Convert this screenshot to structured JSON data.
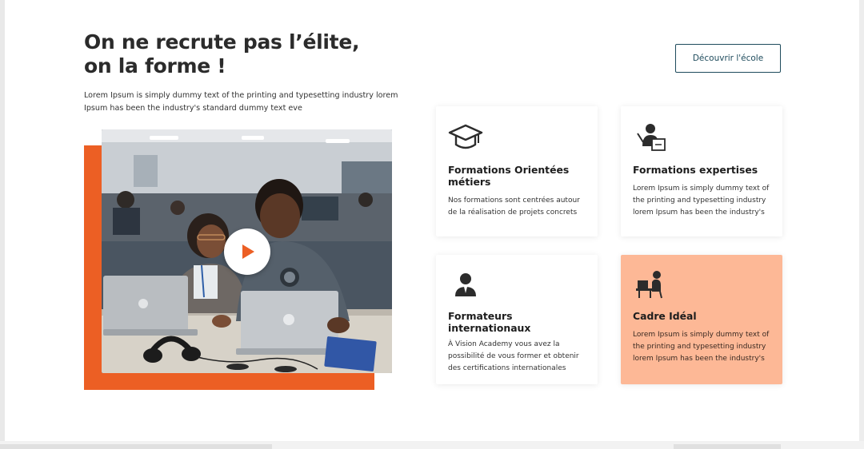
{
  "hero": {
    "title_line1": "On ne recrute pas l’élite,",
    "title_line2": "on la forme !",
    "description": "Lorem Ipsum is simply dummy text of the printing and typesetting industry lorem Ipsum has been the industry's standard dummy text eve",
    "cta_label": "Découvrir l'école"
  },
  "video": {
    "play_icon": "play-icon",
    "accent_color": "#ec5f24"
  },
  "cards": [
    {
      "icon": "graduation-cap-icon",
      "title": "Formations Orientées métiers",
      "text": "Nos formations sont centrées autour de la réalisation de projets concrets"
    },
    {
      "icon": "teacher-board-icon",
      "title": "Formations expertises",
      "text": "Lorem Ipsum is simply dummy text of the printing and typesetting industry lorem Ipsum has been the industry's"
    },
    {
      "icon": "instructor-icon",
      "title": "Formateurs internationaux",
      "text": "À Vision Academy vous avez la possibilité de vous former et obtenir des certifications internationales"
    },
    {
      "icon": "desk-worker-icon",
      "title": "Cadre Idéal",
      "text": "Lorem Ipsum is simply dummy text of the printing and typesetting industry lorem Ipsum has been the industry's",
      "highlight_color": "#fdb896"
    }
  ],
  "colors": {
    "accent": "#ec5f24",
    "button_border": "#1e4b5c",
    "heading": "#2b2b2b"
  }
}
